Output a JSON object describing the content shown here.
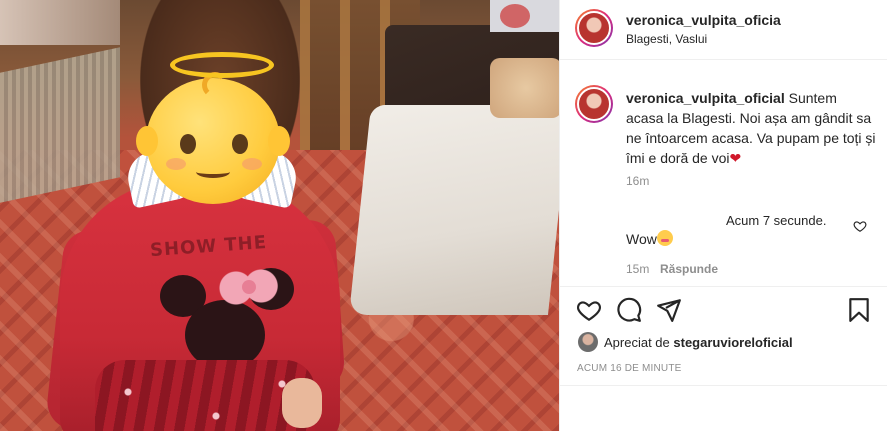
{
  "post": {
    "author": {
      "header_username": "veronica_vulpita_oficia",
      "location": "Blagesti, Vaslui"
    },
    "caption": {
      "username": "veronica_vulpita_oficial",
      "text": "Suntem acasa la Blagesti. Noi așa am gândit sa ne întoarcem acasa. Va pupam pe toți și îmi e doră de voi",
      "emoji": "❤",
      "time": "16m"
    },
    "comment": {
      "meta": "Acum 7 secunde.",
      "text": "Wow",
      "time": "15m",
      "reply_label": "Răspunde"
    },
    "likes": {
      "prefix": "Apreciat de",
      "user": "stegaruvioreloficial"
    },
    "posted_ago": "ACUM 16 DE MINUTE",
    "photo": {
      "shirt_text": "SHOW THE"
    }
  },
  "icons": {
    "like": "heart-outline-icon",
    "comment": "speech-bubble-icon",
    "share": "paper-plane-icon",
    "save": "bookmark-icon"
  },
  "colors": {
    "text": "#262626",
    "secondary": "#8e8e8e",
    "divider": "#efefef"
  }
}
